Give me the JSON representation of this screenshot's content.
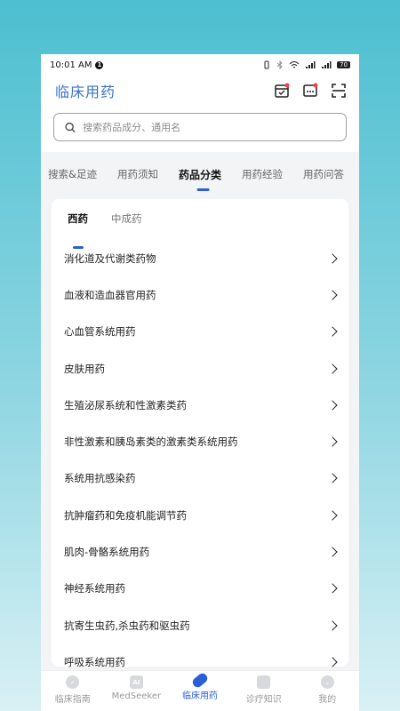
{
  "status_bar": {
    "time": "10:01 AM",
    "notif_count": "1",
    "battery": "70"
  },
  "header": {
    "app_title": "临床用药"
  },
  "search": {
    "placeholder": "搜索药品成分、通用名"
  },
  "tabs": [
    {
      "label": "搜索&足迹"
    },
    {
      "label": "用药须知"
    },
    {
      "label": "药品分类"
    },
    {
      "label": "用药经验"
    },
    {
      "label": "用药问答"
    }
  ],
  "subtabs": [
    {
      "label": "西药"
    },
    {
      "label": "中成药"
    }
  ],
  "categories": [
    {
      "label": "消化道及代谢类药物"
    },
    {
      "label": "血液和造血器官用药"
    },
    {
      "label": "心血管系统用药"
    },
    {
      "label": "皮肤用药"
    },
    {
      "label": "生殖泌尿系统和性激素类药"
    },
    {
      "label": "非性激素和胰岛素类的激素类系统用药"
    },
    {
      "label": "系统用抗感染药"
    },
    {
      "label": "抗肿瘤药和免疫机能调节药"
    },
    {
      "label": "肌肉-骨骼系统用药"
    },
    {
      "label": "神经系统用药"
    },
    {
      "label": "抗寄生虫药,杀虫药和驱虫药"
    },
    {
      "label": "呼吸系统用药"
    }
  ],
  "bottom_nav": [
    {
      "label": "临床指南",
      "icon": "guide-icon"
    },
    {
      "label": "MedSeeker",
      "icon": "ai-icon",
      "icon_text": "AI"
    },
    {
      "label": "临床用药",
      "icon": "pill-icon"
    },
    {
      "label": "诊疗知识",
      "icon": "knowledge-icon"
    },
    {
      "label": "我的",
      "icon": "profile-icon"
    }
  ],
  "colors": {
    "accent": "#2b5fd9",
    "logo": "#3a72c8",
    "badge": "#e5484d"
  }
}
